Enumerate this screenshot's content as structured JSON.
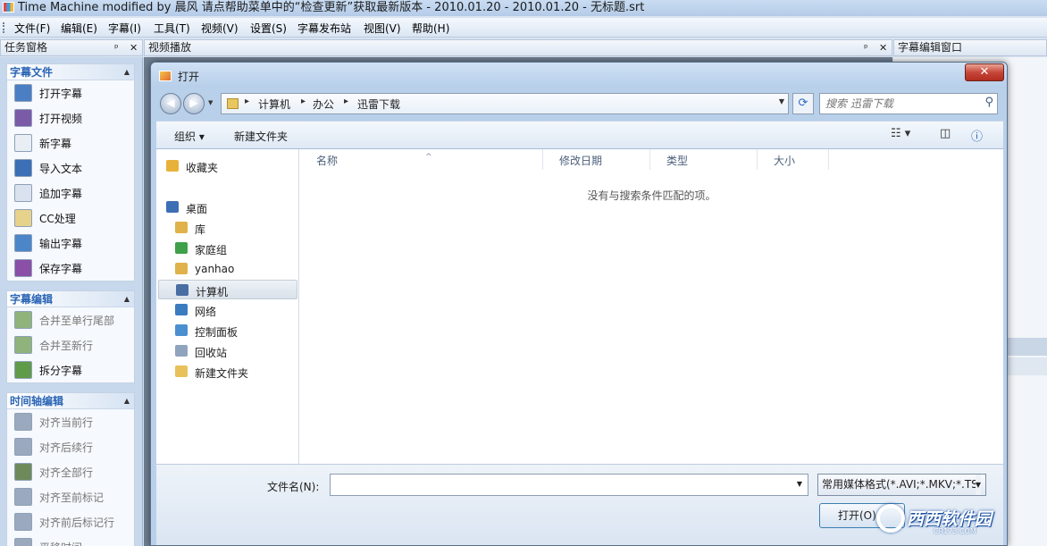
{
  "app": {
    "title": "Time Machine modified by 晨风 请点帮助菜单中的“检查更新”获取最新版本 - 2010.01.20 - 2010.01.20 - 无标题.srt"
  },
  "menu": [
    "文件(F)",
    "编辑(E)",
    "字幕(I)",
    "工具(T)",
    "视频(V)",
    "设置(S)",
    "字幕发布站",
    "视图(V)",
    "帮助(H)"
  ],
  "panels": {
    "task_pane_title": "任务窗格",
    "video_title": "视频播放",
    "editor_title": "字幕编辑窗口",
    "pin_glyph": "ᵖ",
    "close_glyph": "✕"
  },
  "task_groups": [
    {
      "title": "字幕文件",
      "items": [
        {
          "label": "打开字幕",
          "icon": "open-subtitle-icon",
          "color": "#4a7fc4",
          "enabled": true
        },
        {
          "label": "打开视频",
          "icon": "open-video-icon",
          "color": "#7b5aa8",
          "enabled": true
        },
        {
          "label": "新字幕",
          "icon": "new-subtitle-icon",
          "color": "#e9eef5",
          "enabled": true
        },
        {
          "label": "导入文本",
          "icon": "import-text-icon",
          "color": "#3b6fb6",
          "enabled": true
        },
        {
          "label": "追加字幕",
          "icon": "append-subtitle-icon",
          "color": "#d9e2ee",
          "enabled": true
        },
        {
          "label": "CC处理",
          "icon": "cc-process-icon",
          "color": "#e7d28c",
          "enabled": true
        },
        {
          "label": "输出字幕",
          "icon": "export-subtitle-icon",
          "color": "#4b86c9",
          "enabled": true
        },
        {
          "label": "保存字幕",
          "icon": "save-subtitle-icon",
          "color": "#8a4fa6",
          "enabled": true
        }
      ]
    },
    {
      "title": "字幕编辑",
      "items": [
        {
          "label": "合并至单行尾部",
          "icon": "merge-line-end-icon",
          "color": "#8fb37a",
          "enabled": false
        },
        {
          "label": "合并至新行",
          "icon": "merge-new-line-icon",
          "color": "#8fb37a",
          "enabled": false
        },
        {
          "label": "拆分字幕",
          "icon": "split-subtitle-icon",
          "color": "#5f9b48",
          "enabled": true
        }
      ]
    },
    {
      "title": "时间轴编辑",
      "items": [
        {
          "label": "对齐当前行",
          "icon": "align-current-icon",
          "color": "#9aa9bd",
          "enabled": false
        },
        {
          "label": "对齐后续行",
          "icon": "align-following-icon",
          "color": "#9aa9bd",
          "enabled": false
        },
        {
          "label": "对齐全部行",
          "icon": "align-all-icon",
          "color": "#6f8a5a",
          "enabled": false
        },
        {
          "label": "对齐至前标记",
          "icon": "align-prev-mark-icon",
          "color": "#9aa9bd",
          "enabled": false
        },
        {
          "label": "对齐前后标记行",
          "icon": "align-marks-icon",
          "color": "#9aa9bd",
          "enabled": false
        },
        {
          "label": "平移时间",
          "icon": "shift-time-icon",
          "color": "#9aa9bd",
          "enabled": false
        }
      ]
    }
  ],
  "dialog": {
    "title": "打开",
    "close_glyph": "✕",
    "address": [
      "计算机",
      "办公",
      "迅雷下载"
    ],
    "search_placeholder": "搜索 迅雷下载",
    "toolbar": {
      "organize": "组织 ▾",
      "new_folder": "新建文件夹"
    },
    "nav": [
      {
        "label": "收藏夹",
        "icon": "favorites-star-icon",
        "color": "#e8b23a"
      },
      {
        "label": "桌面",
        "icon": "desktop-icon",
        "color": "#3d6fb4"
      },
      {
        "label": "库",
        "icon": "libraries-icon",
        "color": "#e0b24a"
      },
      {
        "label": "家庭组",
        "icon": "homegroup-icon",
        "color": "#3fa04a"
      },
      {
        "label": "yanhao",
        "icon": "user-folder-icon",
        "color": "#e0b24a"
      },
      {
        "label": "计算机",
        "icon": "computer-icon",
        "color": "#4a6ea3"
      },
      {
        "label": "网络",
        "icon": "network-icon",
        "color": "#3b7bbf"
      },
      {
        "label": "控制面板",
        "icon": "control-panel-icon",
        "color": "#4a8fd0"
      },
      {
        "label": "回收站",
        "icon": "recycle-bin-icon",
        "color": "#8fa4bd"
      },
      {
        "label": "新建文件夹",
        "icon": "folder-icon",
        "color": "#e8c15a"
      }
    ],
    "columns": [
      "名称",
      "修改日期",
      "类型",
      "大小"
    ],
    "empty_message": "没有与搜索条件匹配的项。",
    "filename_label": "文件名(N):",
    "filename_value": "",
    "filetype": "常用媒体格式(*.AVI;*.MKV;*.TS",
    "open_button": "打开(O)"
  },
  "watermark": {
    "text": "西西软件园",
    "sub": "CR173.COM"
  }
}
